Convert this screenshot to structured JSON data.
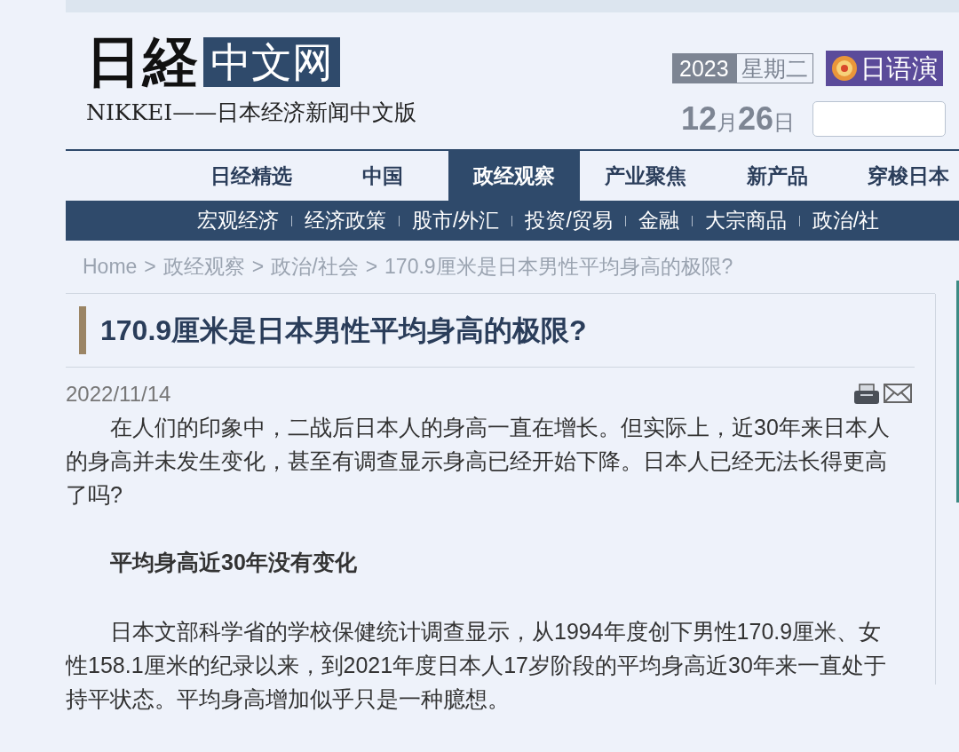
{
  "logo": {
    "mark": "日経",
    "badge": "中文网",
    "subtitle": "NIKKEI——日本经济新闻中文版"
  },
  "date": {
    "year": "2023",
    "weekday": "星期二",
    "month": "12",
    "month_unit": "月",
    "day": "26",
    "day_unit": "日"
  },
  "promo": {
    "label": "日语演"
  },
  "nav": [
    {
      "label": "日经精选",
      "selected": false
    },
    {
      "label": "中国",
      "selected": false
    },
    {
      "label": "政经观察",
      "selected": true
    },
    {
      "label": "产业聚焦",
      "selected": false
    },
    {
      "label": "新产品",
      "selected": false
    },
    {
      "label": "穿梭日本",
      "selected": false
    }
  ],
  "subnav": [
    "宏观经济",
    "经济政策",
    "股市/外汇",
    "投资/贸易",
    "金融",
    "大宗商品",
    "政治/社"
  ],
  "breadcrumb": {
    "separator": ">",
    "items": [
      "Home",
      "政经观察",
      "政治/社会",
      "170.9厘米是日本男性平均身高的极限?"
    ]
  },
  "article": {
    "title": "170.9厘米是日本男性平均身高的极限?",
    "date": "2022/11/14",
    "blocks": [
      {
        "kind": "paragraph",
        "text": "在人们的印象中，二战后日本人的身高一直在增长。但实际上，近30年来日本人的身高并未发生变化，甚至有调查显示身高已经开始下降。日本人已经无法长得更高了吗?"
      },
      {
        "kind": "heading",
        "text": "平均身高近30年没有变化"
      },
      {
        "kind": "paragraph",
        "text": "日本文部科学省的学校保健统计调查显示，从1994年度创下男性170.9厘米、女性158.1厘米的纪录以来，到2021年度日本人17岁阶段的平均身高近30年来一直处于持平状态。平均身高增加似乎只是一种臆想。"
      }
    ]
  }
}
